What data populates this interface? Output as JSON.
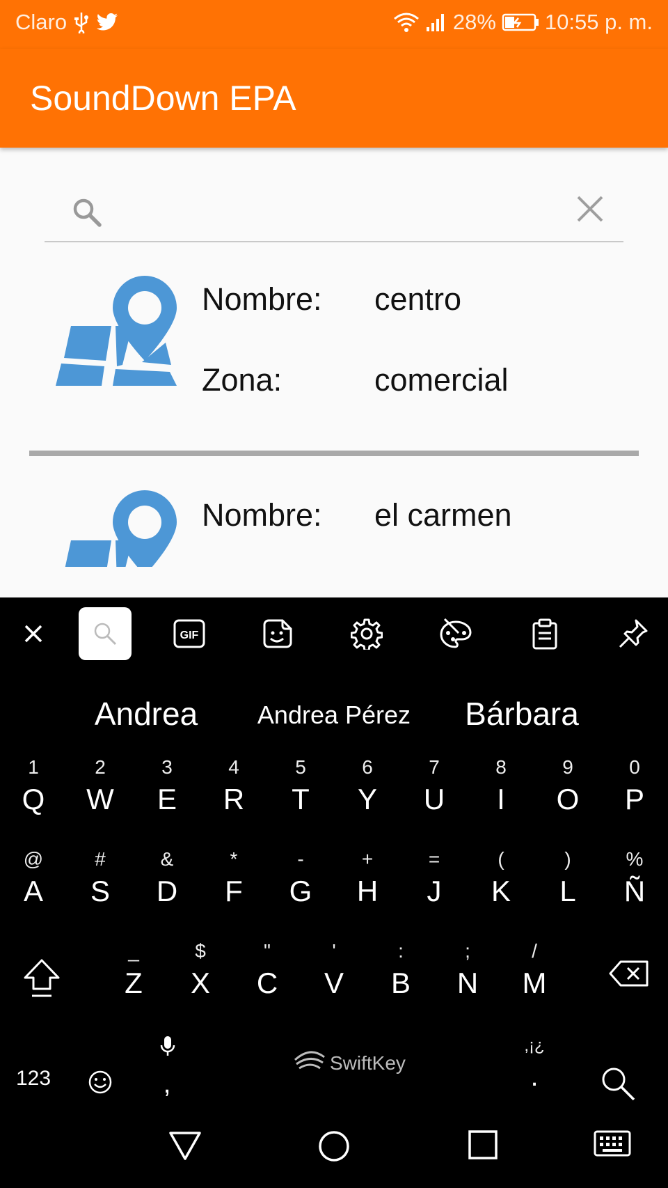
{
  "status_bar": {
    "carrier": "Claro",
    "battery": "28%",
    "time": "10:55 p. m."
  },
  "app_bar": {
    "title": "SoundDown EPA"
  },
  "search": {
    "placeholder": "",
    "value": ""
  },
  "places": [
    {
      "name_label": "Nombre:",
      "name": "centro",
      "zone_label": "Zona:",
      "zone": "comercial"
    },
    {
      "name_label": "Nombre:",
      "name": "el carmen"
    }
  ],
  "keyboard": {
    "toolbar": [
      "close-icon",
      "search-icon",
      "gif-icon",
      "sticker-icon",
      "settings-icon",
      "theme-palette-icon",
      "clipboard-icon",
      "pin-icon"
    ],
    "gif_label": "GIF",
    "suggestions": [
      "Andrea",
      "Andrea Pérez",
      "Bárbara"
    ],
    "row1": [
      {
        "alt": "1",
        "main": "Q"
      },
      {
        "alt": "2",
        "main": "W"
      },
      {
        "alt": "3",
        "main": "E"
      },
      {
        "alt": "4",
        "main": "R"
      },
      {
        "alt": "5",
        "main": "T"
      },
      {
        "alt": "6",
        "main": "Y"
      },
      {
        "alt": "7",
        "main": "U"
      },
      {
        "alt": "8",
        "main": "I"
      },
      {
        "alt": "9",
        "main": "O"
      },
      {
        "alt": "0",
        "main": "P"
      }
    ],
    "row2": [
      {
        "alt": "@",
        "main": "A"
      },
      {
        "alt": "#",
        "main": "S"
      },
      {
        "alt": "&",
        "main": "D"
      },
      {
        "alt": "*",
        "main": "F"
      },
      {
        "alt": "-",
        "main": "G"
      },
      {
        "alt": "+",
        "main": "H"
      },
      {
        "alt": "=",
        "main": "J"
      },
      {
        "alt": "(",
        "main": "K"
      },
      {
        "alt": ")",
        "main": "L"
      },
      {
        "alt": "%",
        "main": "Ñ"
      }
    ],
    "row3": [
      {
        "alt": "_",
        "main": "Z"
      },
      {
        "alt": "$",
        "main": "X"
      },
      {
        "alt": "\"",
        "main": "C"
      },
      {
        "alt": "'",
        "main": "V"
      },
      {
        "alt": ":",
        "main": "B"
      },
      {
        "alt": ";",
        "main": "N"
      },
      {
        "alt": "/",
        "main": "M"
      }
    ],
    "numbers_label": "123",
    "comma": ",",
    "period": ".",
    "period_alt": ",¡¿",
    "brand": "SwiftKey"
  },
  "colors": {
    "accent": "#ff7204",
    "map_blue": "#4d97d6"
  }
}
